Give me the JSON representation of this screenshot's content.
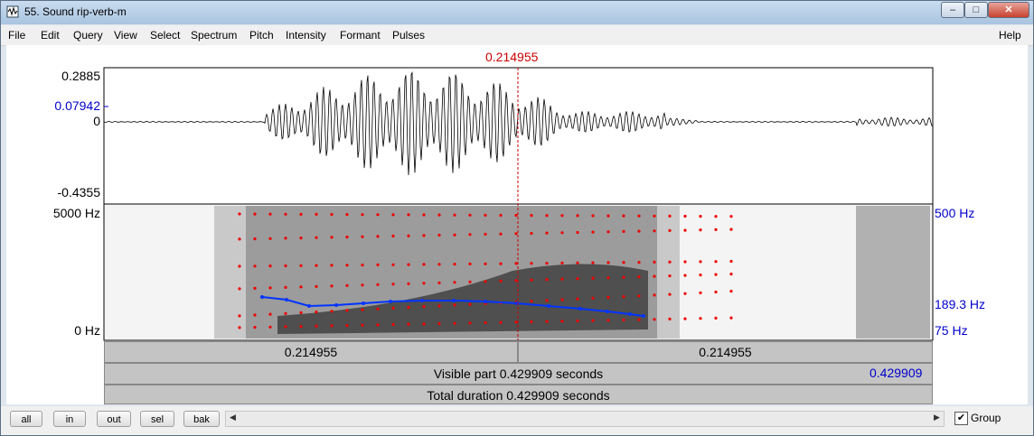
{
  "window": {
    "title": "55. Sound rip-verb-m",
    "minimize": "–",
    "maximize": "□",
    "close": "✕"
  },
  "menu": [
    "File",
    "Edit",
    "Query",
    "View",
    "Select",
    "Spectrum",
    "Pitch",
    "Intensity",
    "Formant",
    "Pulses"
  ],
  "help": "Help",
  "cursor_time": "0.214955",
  "waveform": {
    "ymax": "0.2885",
    "ymark": "0.07942",
    "yzero": "0",
    "ymin": "-0.4355"
  },
  "spectrogram": {
    "fmax": "5000 Hz",
    "fmin": "0 Hz",
    "pitch_max": "500 Hz",
    "pitch_val": "189.3 Hz",
    "pitch_min": "75 Hz"
  },
  "time_bar": {
    "left": "0.214955",
    "right": "0.214955"
  },
  "visible": {
    "start": "0",
    "label": "Visible part 0.429909 seconds",
    "end": "0.429909"
  },
  "total": {
    "label": "Total duration 0.429909 seconds"
  },
  "buttons": [
    "all",
    "in",
    "out",
    "sel",
    "bak"
  ],
  "group": {
    "label": "Group",
    "checked": true
  },
  "colors": {
    "cursor": "#cc0000",
    "axis_blue": "#0000cc",
    "pitch": "#0033ff",
    "formant": "#ee0000"
  }
}
